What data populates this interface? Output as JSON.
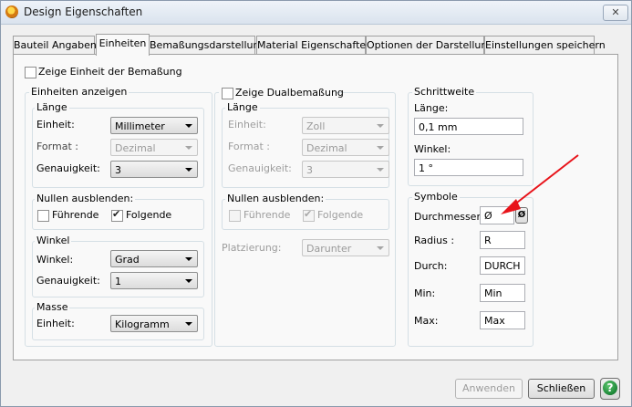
{
  "window": {
    "title": "Design Eigenschaften",
    "close_glyph": "✕"
  },
  "tabs": [
    {
      "label": "Bauteil Angaben"
    },
    {
      "label": "Einheiten"
    },
    {
      "label": "Bemaßungsdarstellung"
    },
    {
      "label": "Material Eigenschaften"
    },
    {
      "label": "Optionen der Darstellung"
    },
    {
      "label": "Einstellungen speichern"
    }
  ],
  "show_unit": {
    "label": "Zeige Einheit der Bemaßung",
    "checked": false
  },
  "units": {
    "title": "Einheiten anzeigen",
    "length": {
      "title": "Länge",
      "unit_label": "Einheit:",
      "unit_value": "Millimeter",
      "format_label": "Format :",
      "format_value": "Dezimal",
      "precision_label": "Genauigkeit:",
      "precision_value": "3"
    },
    "zeros": {
      "title": "Nullen ausblenden:",
      "leading": "Führende",
      "leading_checked": false,
      "trailing": "Folgende",
      "trailing_checked": true
    },
    "angle": {
      "title": "Winkel",
      "angle_label": "Winkel:",
      "angle_value": "Grad",
      "precision_label": "Genauigkeit:",
      "precision_value": "1"
    },
    "mass": {
      "title": "Masse",
      "unit_label": "Einheit:",
      "unit_value": "Kilogramm"
    }
  },
  "dual": {
    "title": "Zeige Dualbemaßung",
    "checked": false,
    "length": {
      "title": "Länge",
      "unit_label": "Einheit:",
      "unit_value": "Zoll",
      "format_label": "Format :",
      "format_value": "Dezimal",
      "precision_label": "Genauigkeit:",
      "precision_value": "3"
    },
    "zeros": {
      "title": "Nullen ausblenden:",
      "leading": "Führende",
      "leading_checked": false,
      "trailing": "Folgende",
      "trailing_checked": true
    },
    "placement_label": "Platzierung:",
    "placement_value": "Darunter"
  },
  "step": {
    "title": "Schrittweite",
    "length_label": "Länge:",
    "length_value": "0,1 mm",
    "angle_label": "Winkel:",
    "angle_value": "1 °"
  },
  "symbols": {
    "title": "Symbole",
    "diameter_label": "Durchmesser:",
    "diameter_value": "Ø",
    "diameter_button": "Ø",
    "radius_label": "Radius :",
    "radius_value": "R",
    "through_label": "Durch:",
    "through_value": "DURCH",
    "min_label": "Min:",
    "min_value": "Min",
    "max_label": "Max:",
    "max_value": "Max"
  },
  "buttons": {
    "apply": "Anwenden",
    "close": "Schließen",
    "help": "?"
  },
  "colors": {
    "annotation_arrow": "#e8131a",
    "help_green": "#1f8a3a"
  }
}
